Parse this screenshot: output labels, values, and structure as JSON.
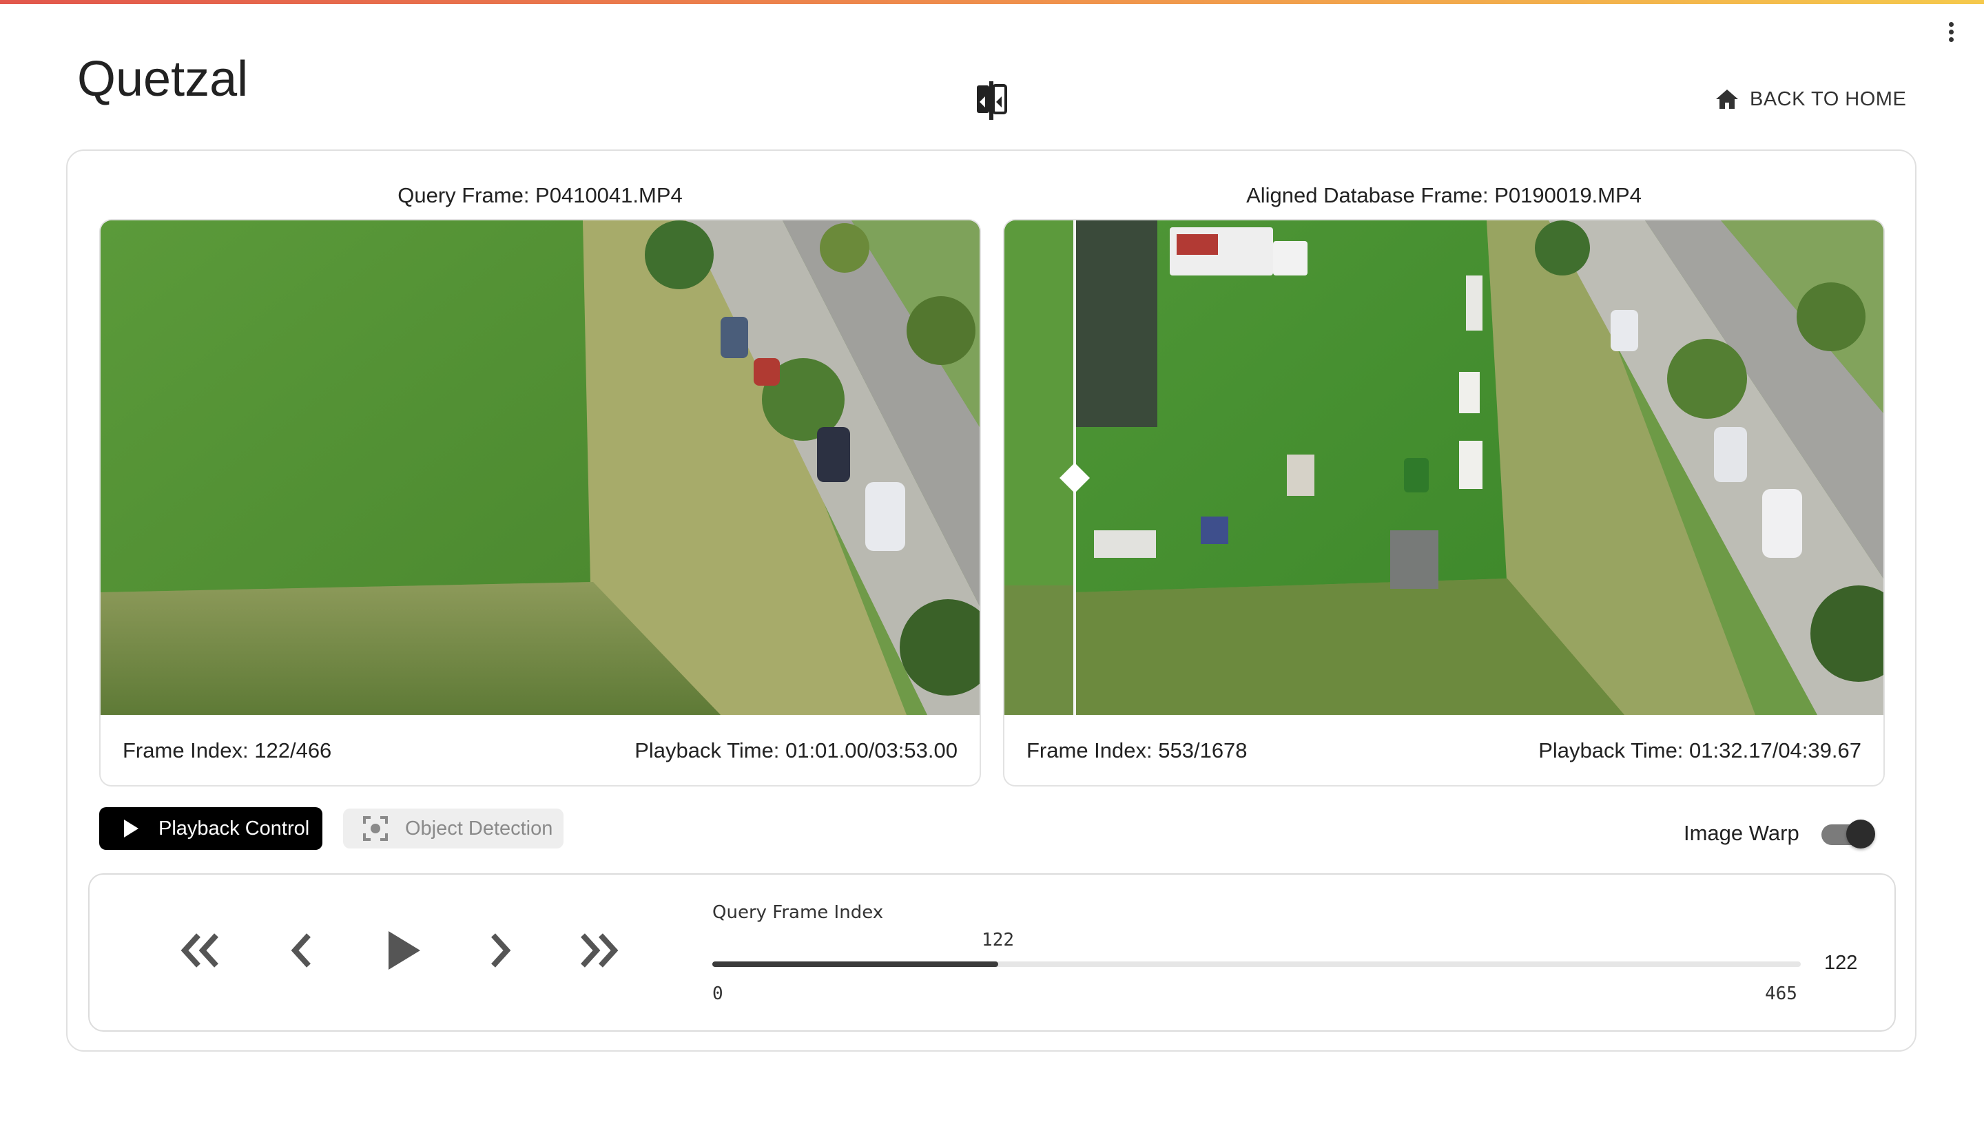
{
  "app": {
    "title": "Quetzal"
  },
  "header": {
    "home_label": "BACK TO HOME"
  },
  "query_frame": {
    "caption": "Query Frame: P0410041.MP4",
    "frame_index": "Frame Index: 122/466",
    "playback_time": "Playback Time: 01:01.00/03:53.00"
  },
  "database_frame": {
    "caption": "Aligned Database Frame: P0190019.MP4",
    "frame_index": "Frame Index: 553/1678",
    "playback_time": "Playback Time: 01:32.17/04:39.67"
  },
  "tabs": [
    {
      "label": "Playback Control",
      "active": true
    },
    {
      "label": "Object Detection",
      "active": false
    }
  ],
  "image_warp": {
    "label": "Image Warp",
    "enabled": true
  },
  "slider": {
    "label": "Query Frame Index",
    "min": 0,
    "max": 465,
    "value": 122,
    "min_label": "0",
    "max_label": "465",
    "value_label": "122",
    "current_label": "122"
  },
  "icons": {
    "menu": "more-vert-icon",
    "swap": "compare-swap-icon",
    "home": "home-icon",
    "play_tab": "play-icon",
    "detect_tab": "center-focus-icon",
    "first": "double-chevron-left-icon",
    "prev": "chevron-left-icon",
    "play": "play-icon",
    "next": "chevron-right-icon",
    "last": "double-chevron-right-icon"
  },
  "colors": {
    "accent_gradient": [
      "#e2574c",
      "#f5c94c"
    ],
    "primary_button": "#000000",
    "slider_fill": "#3b3b3b"
  }
}
